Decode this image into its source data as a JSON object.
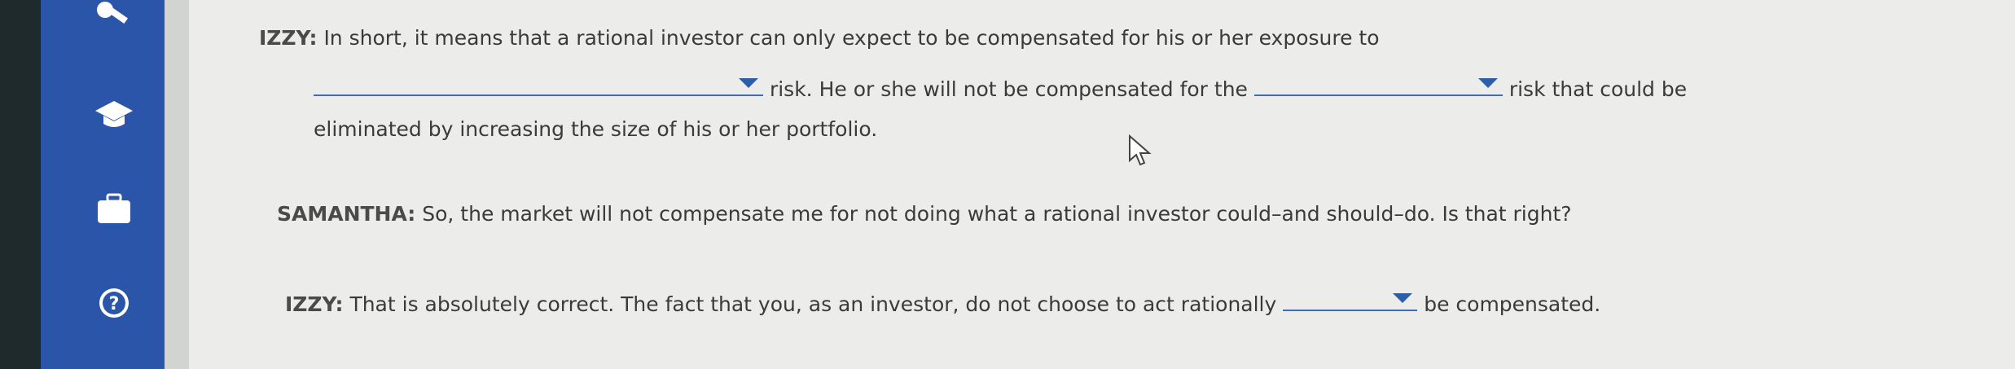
{
  "sidebar": {
    "icons": [
      "key-icon",
      "graduation-cap-icon",
      "briefcase-icon",
      "help-icon"
    ],
    "help_glyph": "?"
  },
  "dialogue": {
    "izzy1": {
      "speaker": "IZZY:",
      "text_a": "In short, it means that a rational investor can only expect to be compensated for his or her exposure to",
      "text_b": "risk. He or she will not be compensated for the",
      "text_c": "risk that could be",
      "text_d": "eliminated by increasing the size of his or her portfolio."
    },
    "samantha": {
      "speaker": "SAMANTHA:",
      "text": "So, the market will not compensate me for not doing what a rational investor could–and should–do. Is that right?"
    },
    "izzy2": {
      "speaker": "IZZY:",
      "text_a": "That is absolutely correct. The fact that you, as an investor, do not choose to act rationally",
      "text_b": "be compensated."
    }
  },
  "dropdowns": {
    "risk_type_1": {
      "selected": ""
    },
    "risk_type_2": {
      "selected": ""
    },
    "modal": {
      "selected": ""
    }
  }
}
